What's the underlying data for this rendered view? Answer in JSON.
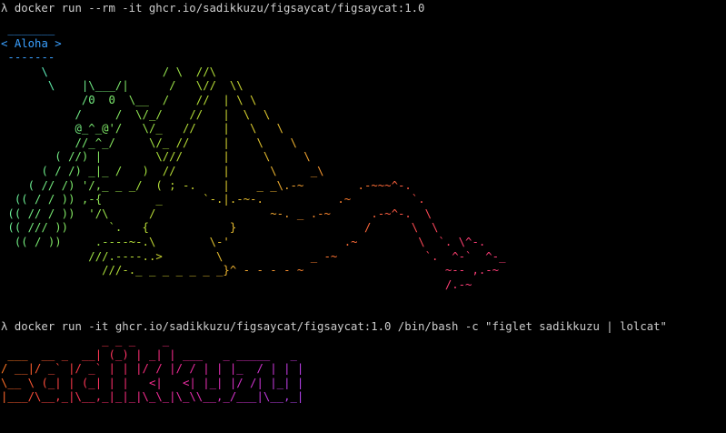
{
  "terminal": {
    "prompt_symbol": "λ",
    "commands": [
      "docker run --rm -it ghcr.io/sadikkuzu/figsaycat/figsaycat:1.0",
      "docker run -it ghcr.io/sadikkuzu/figsaycat/figsaycat:1.0 /bin/bash -c \"figlet sadikkuzu | lolcat\""
    ],
    "speech_bubble_text": "Aloha",
    "cat_art_lines": [
      " _______",
      "< Aloha >",
      " -------",
      "      \\                 / \\  //\\",
      "       \\    |\\___/|      /   \\//  \\\\",
      "            /0  0  \\__  /    //  | \\ \\",
      "           /     /  \\/_/    //   |  \\  \\",
      "           @_^_@'/   \\/_   //    |   \\   \\",
      "           //_^_/     \\/_ //     |    \\    \\",
      "        ( //) |        \\///      |     \\     \\",
      "      ( / /) _|_ /   )  //       |      \\     _\\",
      "    ( // /) '/,_ _ _/  ( ; -.    |    _ _\\.-~        .-~~~^-.",
      "  (( / / )) ,-{        _      `-.|.-~-.           .~         `.",
      " (( // / ))  '/\\      /                 ~-. _ .-~      .-~^-.  \\",
      " (( /// ))      `.   {            }                   /      \\  \\",
      "  (( / ))     .----~-.\\        \\-'                 .~         \\  `. \\^-.",
      "             ///.----..>        \\             _ -~             `.  ^-`  ^-_",
      "               ///-._ _ _ _ _ _ _}^ - - - - ~                     ~-- ,.-~",
      "                                                                  /.-~"
    ],
    "figlet_lines": [
      "               _ _ _    _",
      " ___  __ _  __| (_) | _| | ___   _ _____   _",
      "/ __|/ _` |/ _` | | |/ / |/ / | | |_  / | | |",
      "\\__ \\ (_| | (_| | |   <|   <| |_| |/ /| |_| |",
      "|___/\\__,_|\\__,_|_|_|\\_\\_|\\_\\\\__,_/___|\\__,_|"
    ],
    "colors": {
      "background": "#000000",
      "text": "#cccccc",
      "bubble": "#3aa0ff",
      "cat_gradient": [
        "#58e6ff",
        "#60f0b0",
        "#7be86a",
        "#a8e03a",
        "#d9d12e",
        "#f0a830",
        "#ff7a2e",
        "#ff4d4d",
        "#ff3e78"
      ],
      "figlet_gradient": [
        "#ff8a1c",
        "#ff5f2e",
        "#ff3b4a",
        "#ff2f6e",
        "#f42b94",
        "#e52fb7",
        "#cf36d6",
        "#b344ee"
      ]
    }
  }
}
